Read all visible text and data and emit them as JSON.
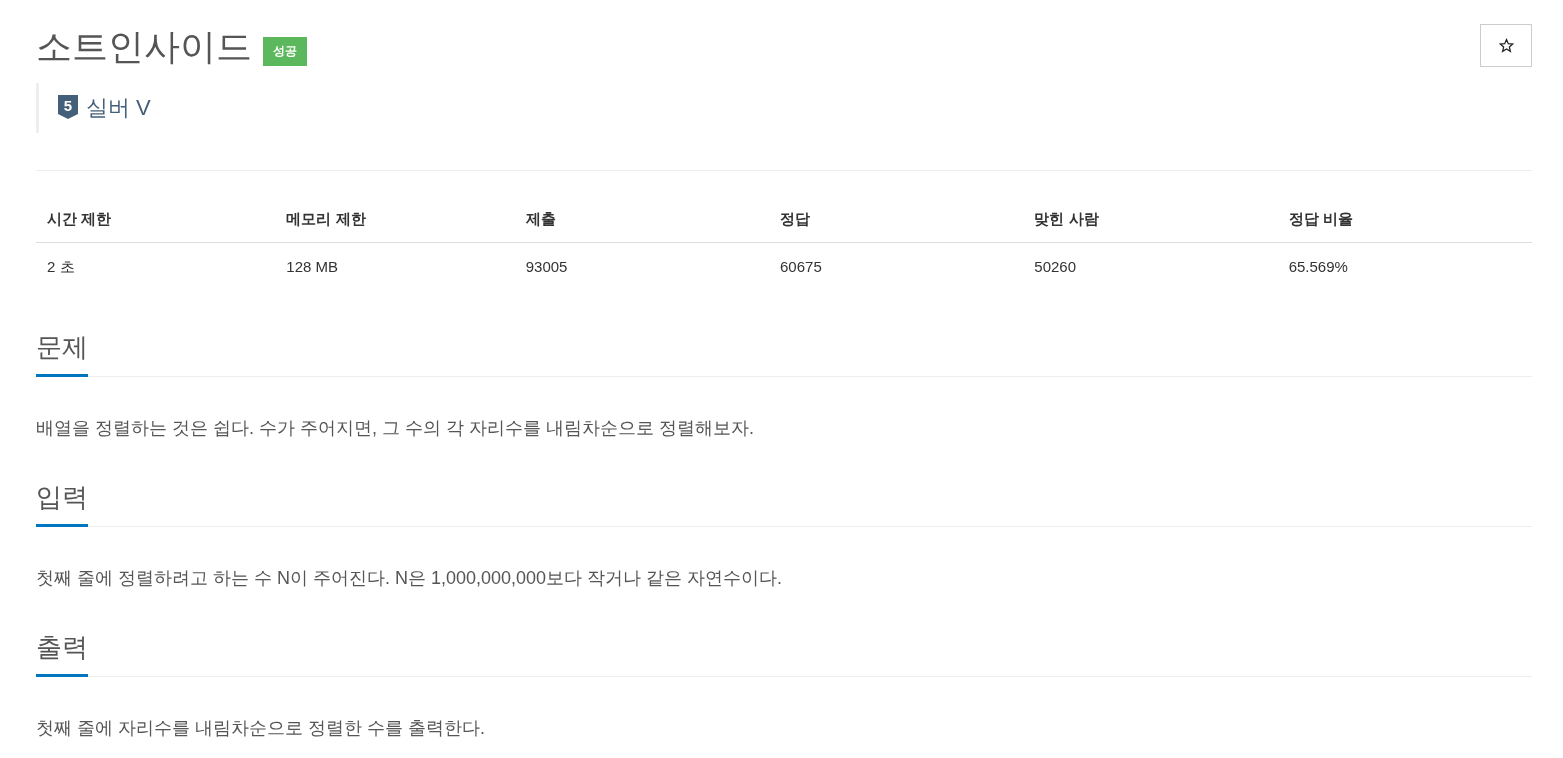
{
  "title": "소트인사이드",
  "result_badge": "성공",
  "tier": {
    "number": "5",
    "label": "실버 V"
  },
  "info_table": {
    "columns": [
      "시간 제한",
      "메모리 제한",
      "제출",
      "정답",
      "맞힌 사람",
      "정답 비율"
    ],
    "rows": [
      [
        "2 초",
        "128 MB",
        "93005",
        "60675",
        "50260",
        "65.569%"
      ]
    ]
  },
  "sections": [
    {
      "heading": "문제",
      "body": "배열을 정렬하는 것은 쉽다. 수가 주어지면, 그 수의 각 자리수를 내림차순으로 정렬해보자."
    },
    {
      "heading": "입력",
      "body": "첫째 줄에 정렬하려고 하는 수 N이 주어진다. N은 1,000,000,000보다 작거나 같은 자연수이다."
    },
    {
      "heading": "출력",
      "body": "첫째 줄에 자리수를 내림차순으로 정렬한 수를 출력한다."
    }
  ]
}
